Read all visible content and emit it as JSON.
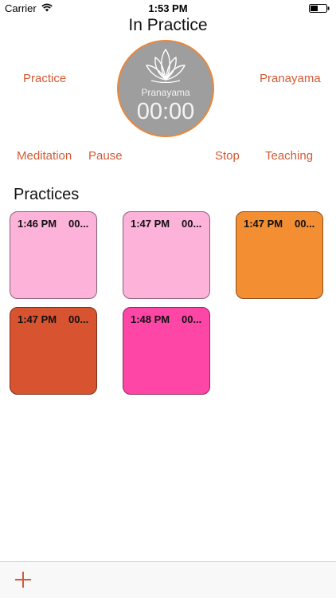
{
  "status_bar": {
    "carrier": "Carrier",
    "time": "1:53 PM"
  },
  "nav": {
    "title": "In Practice"
  },
  "modes": {
    "practice": "Practice",
    "pranayama": "Pranayama",
    "meditation": "Meditation",
    "pause": "Pause",
    "stop": "Stop",
    "teaching": "Teaching"
  },
  "timer": {
    "mode": "Pranayama",
    "value": "00:00"
  },
  "section": {
    "title": "Practices"
  },
  "practices": [
    {
      "time": "1:46 PM",
      "duration": "00...",
      "color": "#fdb2da"
    },
    {
      "time": "1:47 PM",
      "duration": "00...",
      "color": "#fdb2da"
    },
    {
      "time": "1:47 PM",
      "duration": "00...",
      "color": "#f38f32"
    },
    {
      "time": "1:47 PM",
      "duration": "00...",
      "color": "#d85430"
    },
    {
      "time": "1:48 PM",
      "duration": "00...",
      "color": "#fd46a6"
    }
  ],
  "colors": {
    "accent": "#d35a35",
    "timer_bg": "#9e9e9e",
    "timer_ring": "#e8873c"
  },
  "toolbar": {
    "add_icon": "plus-icon"
  }
}
